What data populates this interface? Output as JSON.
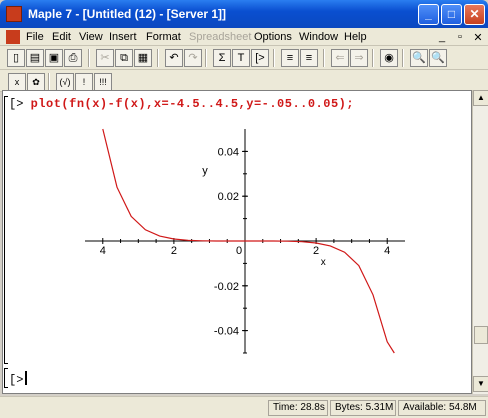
{
  "window": {
    "title": "Maple 7 - [Untitled (12) - [Server 1]]",
    "controls": {
      "minimize": "_",
      "maximize": "□",
      "close": "✕"
    }
  },
  "menu": {
    "items": [
      "File",
      "Edit",
      "View",
      "Insert",
      "Format",
      "Spreadsheet",
      "Options",
      "Window",
      "Help"
    ],
    "mdi": {
      "minimize": "_",
      "restore": "▫",
      "close": "✕"
    }
  },
  "toolbar1": {
    "buttons": [
      {
        "icon": "new-document-icon",
        "glyph": "▯"
      },
      {
        "icon": "open-folder-icon",
        "glyph": "▤"
      },
      {
        "icon": "save-icon",
        "glyph": "▣"
      },
      {
        "icon": "print-icon",
        "glyph": "⎙"
      },
      {
        "icon": "cut-icon",
        "glyph": "✂",
        "disabled": true
      },
      {
        "icon": "copy-icon",
        "glyph": "⧉"
      },
      {
        "icon": "paste-icon",
        "glyph": "▦"
      },
      {
        "icon": "undo-icon",
        "glyph": "↶"
      },
      {
        "icon": "redo-icon",
        "glyph": "↷",
        "disabled": true
      },
      {
        "icon": "sigma-icon",
        "glyph": "Σ"
      },
      {
        "icon": "text-icon",
        "glyph": "T"
      },
      {
        "icon": "execute-group-icon",
        "glyph": "[>"
      },
      {
        "icon": "indent-icon",
        "glyph": "≡"
      },
      {
        "icon": "outdent-icon",
        "glyph": "≡"
      },
      {
        "icon": "back-icon",
        "glyph": "⇐",
        "disabled": true
      },
      {
        "icon": "forward-icon",
        "glyph": "⇒",
        "disabled": true
      },
      {
        "icon": "stop-icon",
        "glyph": "◉"
      },
      {
        "icon": "zoom-in-icon",
        "glyph": "🔍"
      },
      {
        "icon": "zoom-out-icon",
        "glyph": "🔍"
      }
    ]
  },
  "toolbar2": {
    "buttons": [
      {
        "icon": "math-mode-icon",
        "glyph": "x"
      },
      {
        "icon": "maple-leaf-icon",
        "glyph": "✿"
      },
      {
        "icon": "execute-icon",
        "glyph": "(√)"
      },
      {
        "icon": "exclamation-icon",
        "glyph": "!"
      },
      {
        "icon": "execute-all-icon",
        "glyph": "!!!"
      }
    ]
  },
  "worksheet": {
    "prompt": "[>",
    "command": "plot(fn(x)-f(x),x=-4.5..4.5,y=-.05..0.05);",
    "empty_prompt": "[>"
  },
  "chart_data": {
    "type": "line",
    "xlabel": "x",
    "ylabel": "y",
    "xlim": [
      -4.5,
      4.5
    ],
    "ylim": [
      -0.05,
      0.05
    ],
    "x_ticks": [
      "4",
      "2",
      "0",
      "2",
      "4"
    ],
    "y_ticks": [
      "0.04",
      "0.02",
      "0",
      "-0.02",
      "-0.04"
    ],
    "color": "#d01818",
    "series": [
      {
        "x": [
          -4.0,
          -3.6,
          -3.2,
          -2.8,
          -2.4,
          -2.0,
          -1.6,
          -1.2,
          -0.8,
          -0.4,
          0.0,
          0.4,
          0.8,
          1.2,
          1.6,
          2.0,
          2.4,
          2.8,
          3.2,
          3.6,
          4.0,
          4.2
        ],
        "y": [
          0.05,
          0.024,
          0.011,
          0.005,
          0.0022,
          0.0009,
          0.0003,
          0.0001,
          0.0,
          0.0,
          0.0,
          0.0,
          0.0,
          -0.0001,
          -0.0003,
          -0.0009,
          -0.0022,
          -0.005,
          -0.011,
          -0.024,
          -0.045,
          -0.05
        ]
      }
    ]
  },
  "status": {
    "time": "Time: 28.8s",
    "bytes": "Bytes: 5.31M",
    "available": "Available: 54.8M"
  }
}
